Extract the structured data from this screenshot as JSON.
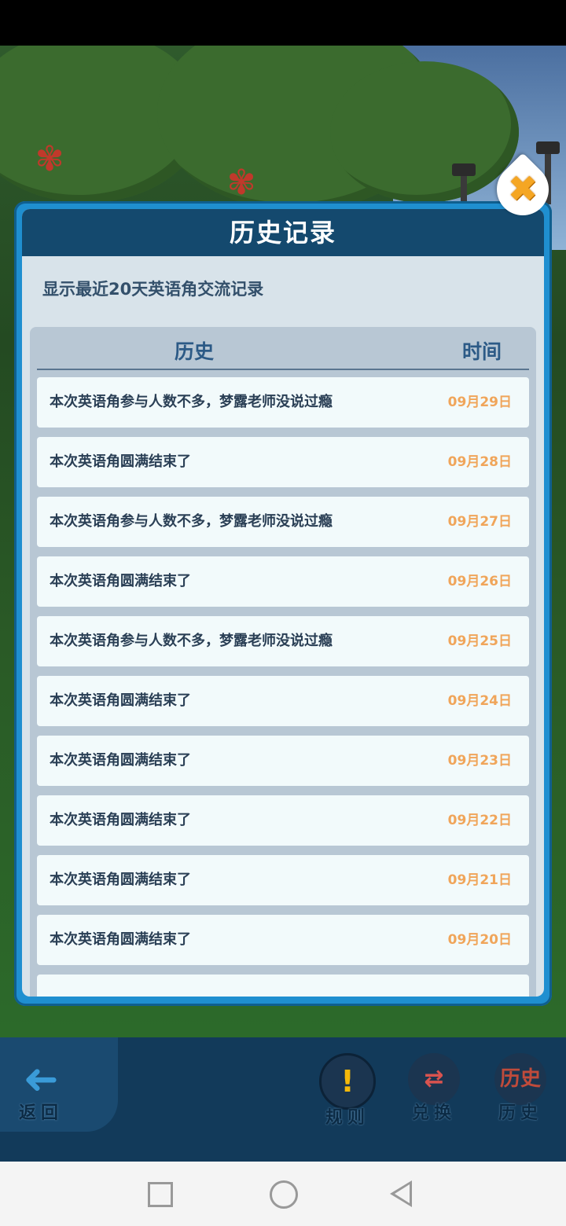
{
  "modal": {
    "title": "历史记录",
    "subtitle": "显示最近20天英语角交流记录",
    "col_history": "历史",
    "col_time": "时间",
    "close_icon": "close-x-icon",
    "rows": [
      {
        "text": "本次英语角参与人数不多，梦露老师没说过瘾",
        "date": "09月29日"
      },
      {
        "text": "本次英语角圆满结束了",
        "date": "09月28日"
      },
      {
        "text": "本次英语角参与人数不多，梦露老师没说过瘾",
        "date": "09月27日"
      },
      {
        "text": "本次英语角圆满结束了",
        "date": "09月26日"
      },
      {
        "text": "本次英语角参与人数不多，梦露老师没说过瘾",
        "date": "09月25日"
      },
      {
        "text": "本次英语角圆满结束了",
        "date": "09月24日"
      },
      {
        "text": "本次英语角圆满结束了",
        "date": "09月23日"
      },
      {
        "text": "本次英语角圆满结束了",
        "date": "09月22日"
      },
      {
        "text": "本次英语角圆满结束了",
        "date": "09月21日"
      },
      {
        "text": "本次英语角圆满结束了",
        "date": "09月20日"
      },
      {
        "text": "",
        "date": ""
      }
    ]
  },
  "bottom_nav": {
    "back": "返回",
    "rules": "规则",
    "exchange": "兑换",
    "history": "历史",
    "rules_icon_glyph": "!",
    "back_icon_glyph": "➜",
    "exchange_icon_glyph": "⇄",
    "history_icon_glyph": "历史"
  },
  "colors": {
    "modal_frame": "#1f8fd0",
    "header": "#14496e",
    "date_text": "#f0a55a",
    "row_bg": "#f2fafb"
  }
}
